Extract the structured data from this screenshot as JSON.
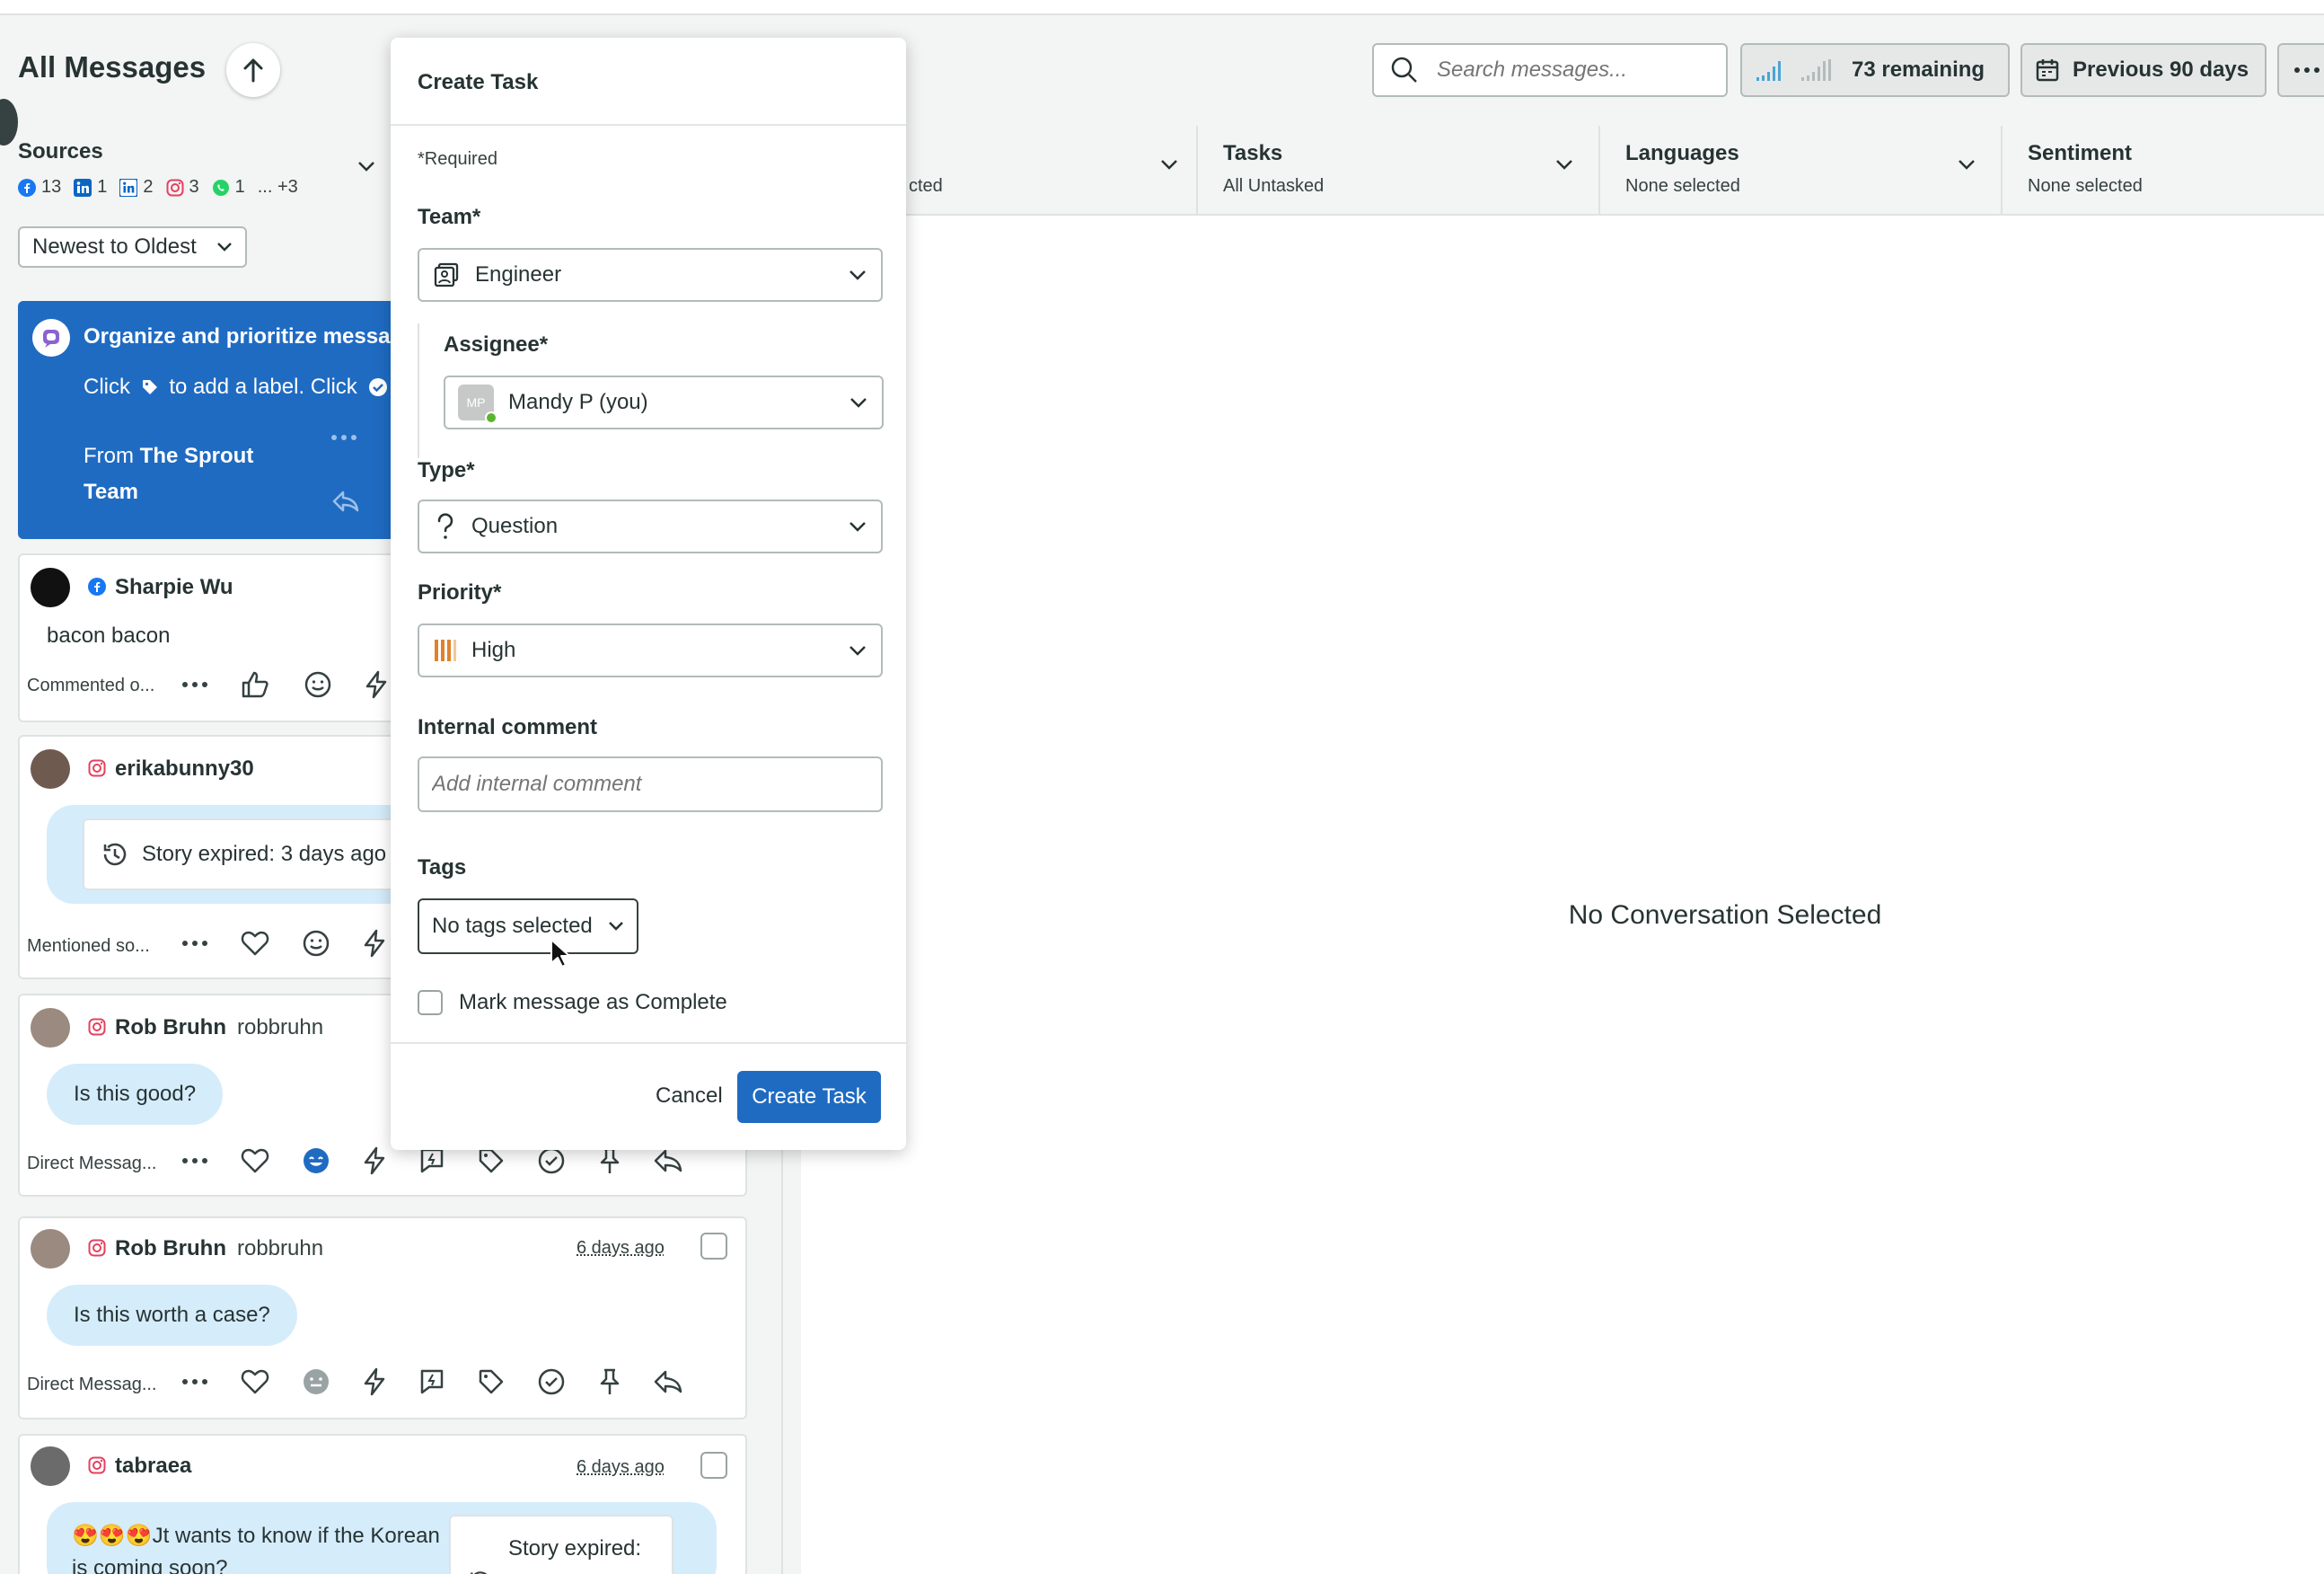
{
  "header": {
    "title": "All Messages",
    "search_placeholder": "Search messages...",
    "remaining": "73 remaining",
    "period": "Previous 90 days"
  },
  "sources": {
    "label": "Sources",
    "items": [
      {
        "icon": "facebook-icon",
        "count": "13"
      },
      {
        "icon": "linkedin-icon",
        "count": "1"
      },
      {
        "icon": "linkedin-pages-icon",
        "count": "2"
      },
      {
        "icon": "instagram-icon",
        "count": "3"
      },
      {
        "icon": "whatsapp-icon",
        "count": "1"
      },
      {
        "icon": "more",
        "count": "... +3"
      }
    ]
  },
  "sort": {
    "value": "Newest to Oldest"
  },
  "filters": [
    {
      "name": "",
      "value": "cted"
    },
    {
      "name": "Tasks",
      "value": "All Untasked"
    },
    {
      "name": "Languages",
      "value": "None selected"
    },
    {
      "name": "Sentiment",
      "value": "None selected"
    }
  ],
  "promo": {
    "heading": "Organize and prioritize messa",
    "body_a": "Click",
    "body_b": "to add a label. Click",
    "from_prefix": "From",
    "from_team": "The Sprout Team"
  },
  "messages": [
    {
      "name": "Sharpie Wu",
      "handle": "",
      "network": "facebook",
      "text": "bacon bacon",
      "meta": "Commented o...",
      "ago": ""
    },
    {
      "name": "erikabunny30",
      "handle": "",
      "network": "instagram",
      "text": "Story expired: 3 days ago",
      "meta": "Mentioned so...",
      "ago": ""
    },
    {
      "name": "Rob Bruhn",
      "handle": "robbruhn",
      "network": "instagram",
      "text": "Is this good?",
      "meta": "Direct Messag...",
      "ago": ""
    },
    {
      "name": "Rob Bruhn",
      "handle": "robbruhn",
      "network": "instagram",
      "text": "Is this worth a case?",
      "meta": "Direct Messag...",
      "ago": "6 days ago"
    },
    {
      "name": "tabraea",
      "handle": "",
      "network": "instagram",
      "text": "😍😍😍Jt wants to know if the Korean is coming soon?",
      "story": "Story expired:",
      "meta": "",
      "ago": "6 days ago"
    }
  ],
  "main": {
    "empty_text": "No Conversation Selected"
  },
  "modal": {
    "title": "Create Task",
    "required_note": "*Required",
    "team_label": "Team*",
    "team_value": "Engineer",
    "assignee_label": "Assignee*",
    "assignee_initials": "MP",
    "assignee_value": "Mandy P (you)",
    "type_label": "Type*",
    "type_value": "Question",
    "priority_label": "Priority*",
    "priority_value": "High",
    "comment_label": "Internal comment",
    "comment_placeholder": "Add internal comment",
    "tags_label": "Tags",
    "tags_value": "No tags selected",
    "complete_label": "Mark message as Complete",
    "cancel_label": "Cancel",
    "create_label": "Create Task"
  },
  "colors": {
    "accent": "#1f6bc2",
    "bubble": "#d5ecfb",
    "priority_high": "#e0822b"
  }
}
